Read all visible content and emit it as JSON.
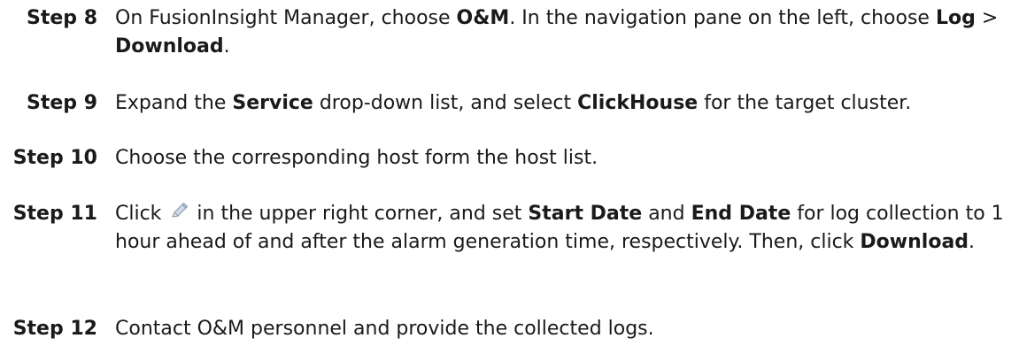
{
  "steps": [
    {
      "label": "Step 8",
      "parts": {
        "t1": "On FusionInsight Manager, choose ",
        "b1": "O&M",
        "t2": ". In the navigation pane on the left, choose ",
        "b2": "Log",
        "t3": " > ",
        "b3": "Download",
        "t4": "."
      }
    },
    {
      "label": "Step 9",
      "parts": {
        "t1": "Expand the ",
        "b1": "Service",
        "t2": " drop-down list, and select ",
        "b2": "ClickHouse",
        "t3": " for the target cluster."
      }
    },
    {
      "label": "Step 10",
      "parts": {
        "t1": "Choose the corresponding host form the host list."
      }
    },
    {
      "label": "Step 11",
      "parts": {
        "t1": "Click ",
        "icon": "pencil-edit-icon",
        "t2": " in the upper right corner, and set ",
        "b1": "Start Date",
        "t3": " and ",
        "b2": "End Date",
        "t4": " for log collection to 1 hour ahead of and after the alarm generation time, respectively. Then, click ",
        "b3": "Download",
        "t5": "."
      }
    },
    {
      "label": "Step 12",
      "parts": {
        "t1": "Contact O&M personnel and provide the collected logs."
      }
    }
  ]
}
